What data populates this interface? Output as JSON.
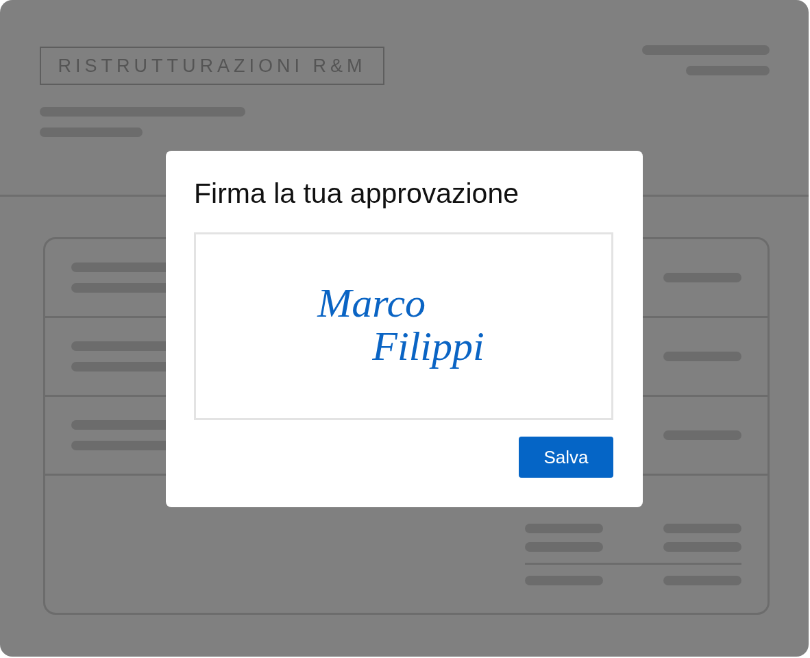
{
  "logo": "RISTRUTTURAZIONI R&M",
  "dialog": {
    "title": "Firma la tua approvazione",
    "signature": {
      "lines": [
        "Marco",
        "Filippi"
      ]
    },
    "buttons": [
      {
        "label": "Salva"
      }
    ]
  }
}
